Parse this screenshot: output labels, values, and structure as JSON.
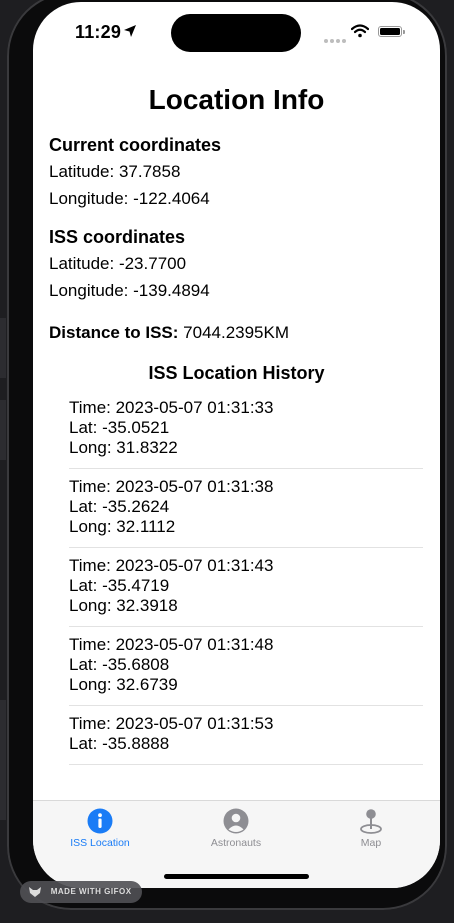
{
  "status": {
    "time": "11:29"
  },
  "page": {
    "title": "Location Info"
  },
  "current": {
    "heading": "Current coordinates",
    "latitude": "Latitude: 37.7858",
    "longitude": "Longitude: -122.4064"
  },
  "iss": {
    "heading": "ISS coordinates",
    "latitude": "Latitude: -23.7700",
    "longitude": "Longitude: -139.4894"
  },
  "distance": {
    "label": "Distance to ISS:",
    "value": "7044.2395KM"
  },
  "history": {
    "heading": "ISS Location History",
    "items": [
      {
        "time": "Time: 2023-05-07 01:31:33",
        "lat": "Lat: -35.0521",
        "long": "Long: 31.8322"
      },
      {
        "time": "Time: 2023-05-07 01:31:38",
        "lat": "Lat: -35.2624",
        "long": "Long: 32.1112"
      },
      {
        "time": "Time: 2023-05-07 01:31:43",
        "lat": "Lat: -35.4719",
        "long": "Long: 32.3918"
      },
      {
        "time": "Time: 2023-05-07 01:31:48",
        "lat": "Lat: -35.6808",
        "long": "Long: 32.6739"
      },
      {
        "time": "Time: 2023-05-07 01:31:53",
        "lat": "Lat: -35.8888",
        "long": ""
      }
    ]
  },
  "tabs": [
    {
      "label": "ISS Location",
      "icon": "info-icon",
      "active": true
    },
    {
      "label": "Astronauts",
      "icon": "person-icon",
      "active": false
    },
    {
      "label": "Map",
      "icon": "map-pin-icon",
      "active": false
    }
  ],
  "colors": {
    "accent": "#1a7cf6",
    "inactive": "#8e8e93",
    "tabbar": "#f6f6f6"
  },
  "watermark": {
    "text": "MADE WITH GIFOX"
  }
}
